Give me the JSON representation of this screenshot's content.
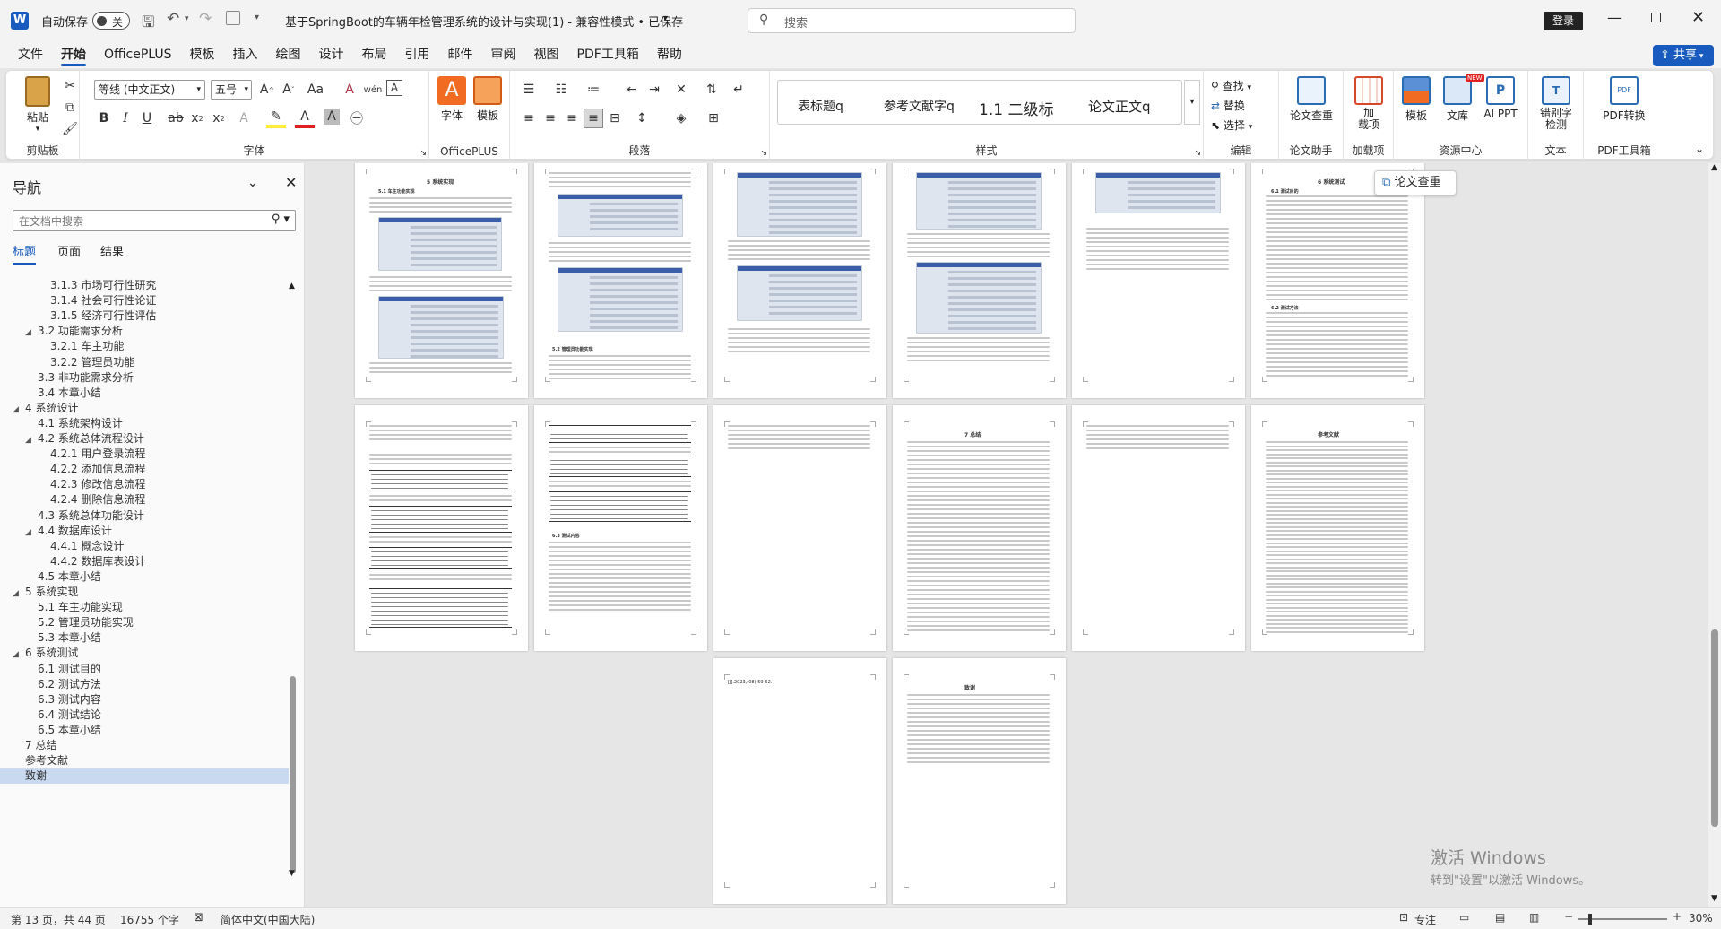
{
  "titlebar": {
    "autosave_label": "自动保存",
    "autosave_state": "关",
    "doc_title": "基于SpringBoot的车辆年检管理系统的设计与实现(1)  -  兼容性模式 • 已保存",
    "search_placeholder": "搜索",
    "login_label": "登录"
  },
  "tabs": [
    "文件",
    "开始",
    "OfficePLUS",
    "模板",
    "插入",
    "绘图",
    "设计",
    "布局",
    "引用",
    "邮件",
    "审阅",
    "视图",
    "PDF工具箱",
    "帮助"
  ],
  "active_tab": "开始",
  "share_label": "共享",
  "ribbon": {
    "clipboard": {
      "paste": "粘贴",
      "label": "剪贴板"
    },
    "font": {
      "name": "等线 (中文正文)",
      "size": "五号",
      "label": "字体"
    },
    "officeplus": {
      "font_btn": "字体",
      "template_btn": "模板",
      "label": "OfficePLUS"
    },
    "paragraph": {
      "label": "段落"
    },
    "styles": {
      "items": [
        "表标题q",
        "参考文献字q",
        "1.1  二级标",
        "论文正文q"
      ],
      "label": "样式"
    },
    "editing": {
      "find": "查找",
      "replace": "替换",
      "select": "选择",
      "label": "编辑"
    },
    "paper_check": {
      "btn": "论文查重",
      "label": "论文助手"
    },
    "addins": {
      "btn": "加\n载项",
      "label": "加载项"
    },
    "resources": {
      "template": "模板",
      "library": "文库",
      "ai_ppt": "AI PPT",
      "label": "资源中心",
      "new_badge": "NEW"
    },
    "text": {
      "btn": "错别字\n检测",
      "label": "文本"
    },
    "pdf": {
      "btn": "PDF转换",
      "label": "PDF工具箱"
    }
  },
  "nav": {
    "title": "导航",
    "search_placeholder": "在文档中搜索",
    "tabs": [
      "标题",
      "页面",
      "结果"
    ],
    "items": [
      {
        "text": "3.1.3 市场可行性研究",
        "level": 3
      },
      {
        "text": "3.1.4 社会可行性论证",
        "level": 3
      },
      {
        "text": "3.1.5 经济可行性评估",
        "level": 3
      },
      {
        "text": "3.2 功能需求分析",
        "level": 2,
        "caret": "◢"
      },
      {
        "text": "3.2.1 车主功能",
        "level": 3
      },
      {
        "text": "3.2.2 管理员功能",
        "level": 3
      },
      {
        "text": "3.3 非功能需求分析",
        "level": 2
      },
      {
        "text": "3.4 本章小结",
        "level": 2
      },
      {
        "text": "4 系统设计",
        "level": 1,
        "caret": "◢"
      },
      {
        "text": "4.1 系统架构设计",
        "level": 2
      },
      {
        "text": "4.2 系统总体流程设计",
        "level": 2,
        "caret": "◢"
      },
      {
        "text": "4.2.1 用户登录流程",
        "level": 3
      },
      {
        "text": "4.2.2 添加信息流程",
        "level": 3
      },
      {
        "text": "4.2.3 修改信息流程",
        "level": 3
      },
      {
        "text": "4.2.4 删除信息流程",
        "level": 3
      },
      {
        "text": "4.3 系统总体功能设计",
        "level": 2
      },
      {
        "text": "4.4 数据库设计",
        "level": 2,
        "caret": "◢"
      },
      {
        "text": "4.4.1 概念设计",
        "level": 3
      },
      {
        "text": "4.4.2 数据库表设计",
        "level": 3
      },
      {
        "text": "4.5 本章小结",
        "level": 2
      },
      {
        "text": "5 系统实现",
        "level": 1,
        "caret": "◢"
      },
      {
        "text": "5.1 车主功能实现",
        "level": 2
      },
      {
        "text": "5.2 管理员功能实现",
        "level": 2
      },
      {
        "text": "5.3 本章小结",
        "level": 2
      },
      {
        "text": "6 系统测试",
        "level": 1,
        "caret": "◢"
      },
      {
        "text": "6.1 测试目的",
        "level": 2
      },
      {
        "text": "6.2 测试方法",
        "level": 2
      },
      {
        "text": "6.3 测试内容",
        "level": 2
      },
      {
        "text": "6.4 测试结论",
        "level": 2
      },
      {
        "text": "6.5 本章小结",
        "level": 2
      },
      {
        "text": "7 总结",
        "level": 1
      },
      {
        "text": "参考文献",
        "level": 1
      },
      {
        "text": "致谢",
        "level": 1,
        "selected": true
      }
    ]
  },
  "pages": {
    "p1_heading": "5  系统实现",
    "p1_sub": "5.1 车主功能实现",
    "p2_sub": "5.2 管理员功能实现",
    "p6_heading": "6  系统测试",
    "p6_sub1": "6.1 测试目的",
    "p6_sub2": "6.2 测试方法",
    "p7_sub": "6.3 测试内容",
    "p8_sub1": "6.4 测试结论",
    "p8_sub2": "6.5 本章小结",
    "p10_heading": "7  总结",
    "p12_heading": "参考文献",
    "p13_note": "[J].2023,(08):59-62.",
    "p14_heading": "致谢"
  },
  "floating_tooltip": "论文查重",
  "watermark": {
    "line1": "激活 Windows",
    "line2": "转到\"设置\"以激活 Windows。"
  },
  "status": {
    "page": "第 13 页，共 44 页",
    "words": "16755 个字",
    "language": "简体中文(中国大陆)",
    "focus": "专注",
    "zoom": "30%"
  }
}
